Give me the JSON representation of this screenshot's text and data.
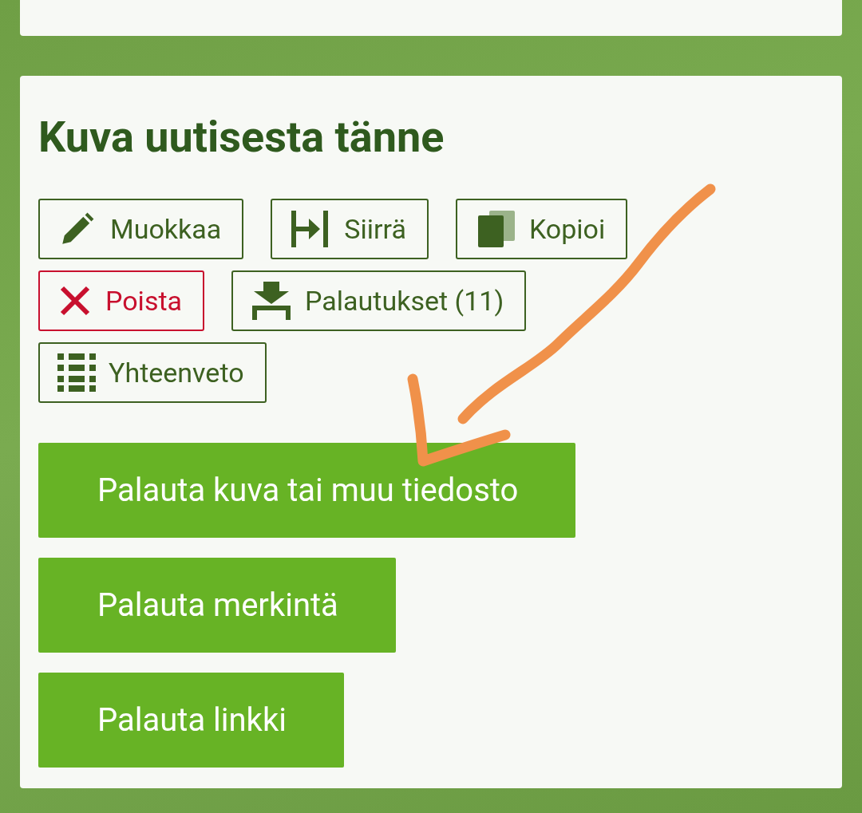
{
  "card_heading": "Kuva uutisesta tänne",
  "tool_buttons": [
    {
      "label": "Muokkaa",
      "kind": "edit"
    },
    {
      "label": "Siirrä",
      "kind": "move"
    },
    {
      "label": "Kopioi",
      "kind": "copy"
    },
    {
      "label": "Poista",
      "kind": "delete"
    },
    {
      "label": "Palautukset (11)",
      "kind": "submissions"
    },
    {
      "label": "Yhteenveto",
      "kind": "summary"
    }
  ],
  "action_buttons": [
    "Palauta kuva tai muu tiedosto",
    "Palauta merkintä",
    "Palauta linkki"
  ]
}
